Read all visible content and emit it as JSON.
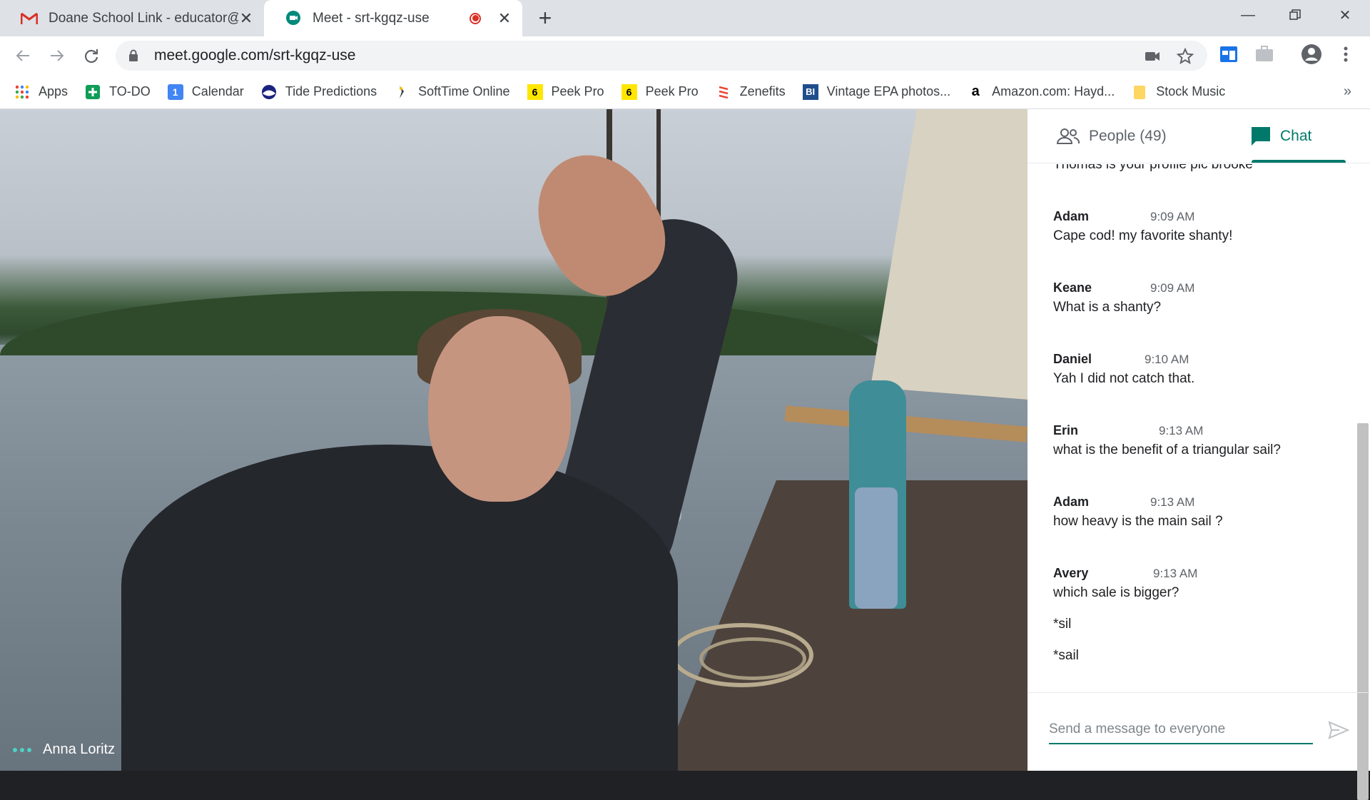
{
  "browser": {
    "tabs": [
      {
        "title": "Doane School Link - educator@c",
        "icon": "gmail-icon"
      },
      {
        "title": "Meet - srt-kgqz-use",
        "icon": "meet-icon",
        "recording": true
      }
    ],
    "url": "meet.google.com/srt-kgqz-use",
    "bookmarks": [
      {
        "label": "Apps",
        "icon": "apps-grid-icon"
      },
      {
        "label": "TO-DO",
        "icon": "plus-box-icon"
      },
      {
        "label": "Calendar",
        "icon": "calendar-icon",
        "glyph": "1"
      },
      {
        "label": "Tide Predictions",
        "icon": "noaa-icon"
      },
      {
        "label": "SoftTime Online",
        "icon": "bird-icon"
      },
      {
        "label": "Peek Pro",
        "icon": "six-icon",
        "glyph": "6"
      },
      {
        "label": "Peek Pro",
        "icon": "six-icon",
        "glyph": "6"
      },
      {
        "label": "Zenefits",
        "icon": "zenefits-icon"
      },
      {
        "label": "Vintage EPA photos...",
        "icon": "bi-icon",
        "glyph": "BI"
      },
      {
        "label": "Amazon.com: Hayd...",
        "icon": "amazon-icon",
        "glyph": "a"
      },
      {
        "label": "Stock Music",
        "icon": "folder-icon"
      }
    ],
    "more_glyph": "»"
  },
  "video": {
    "participant_name": "Anna Loritz"
  },
  "panel": {
    "people_label": "People (49)",
    "chat_label": "Chat",
    "partial_message": "Thomas is your profile pic brooke",
    "messages": [
      {
        "sender": "Adam",
        "time": "9:09 AM",
        "text": "Cape cod! my favorite shanty!"
      },
      {
        "sender": "Keane",
        "time": "9:09 AM",
        "text": "What is a shanty?"
      },
      {
        "sender": "Daniel",
        "time": "9:10 AM",
        "text": "Yah I did not catch that."
      },
      {
        "sender": "Erin",
        "time": "9:13 AM",
        "text": "what is the benefit of a triangular sail?"
      },
      {
        "sender": "Adam",
        "time": "9:13 AM",
        "text": "how heavy is the main sail ?"
      },
      {
        "sender": "Avery",
        "time": "9:13 AM",
        "text": "which sale is bigger?",
        "extra": [
          "*sil",
          "*sail"
        ]
      }
    ],
    "input_placeholder": "Send a message to everyone"
  },
  "colors": {
    "accent": "#00796b",
    "record": "#d93025"
  }
}
